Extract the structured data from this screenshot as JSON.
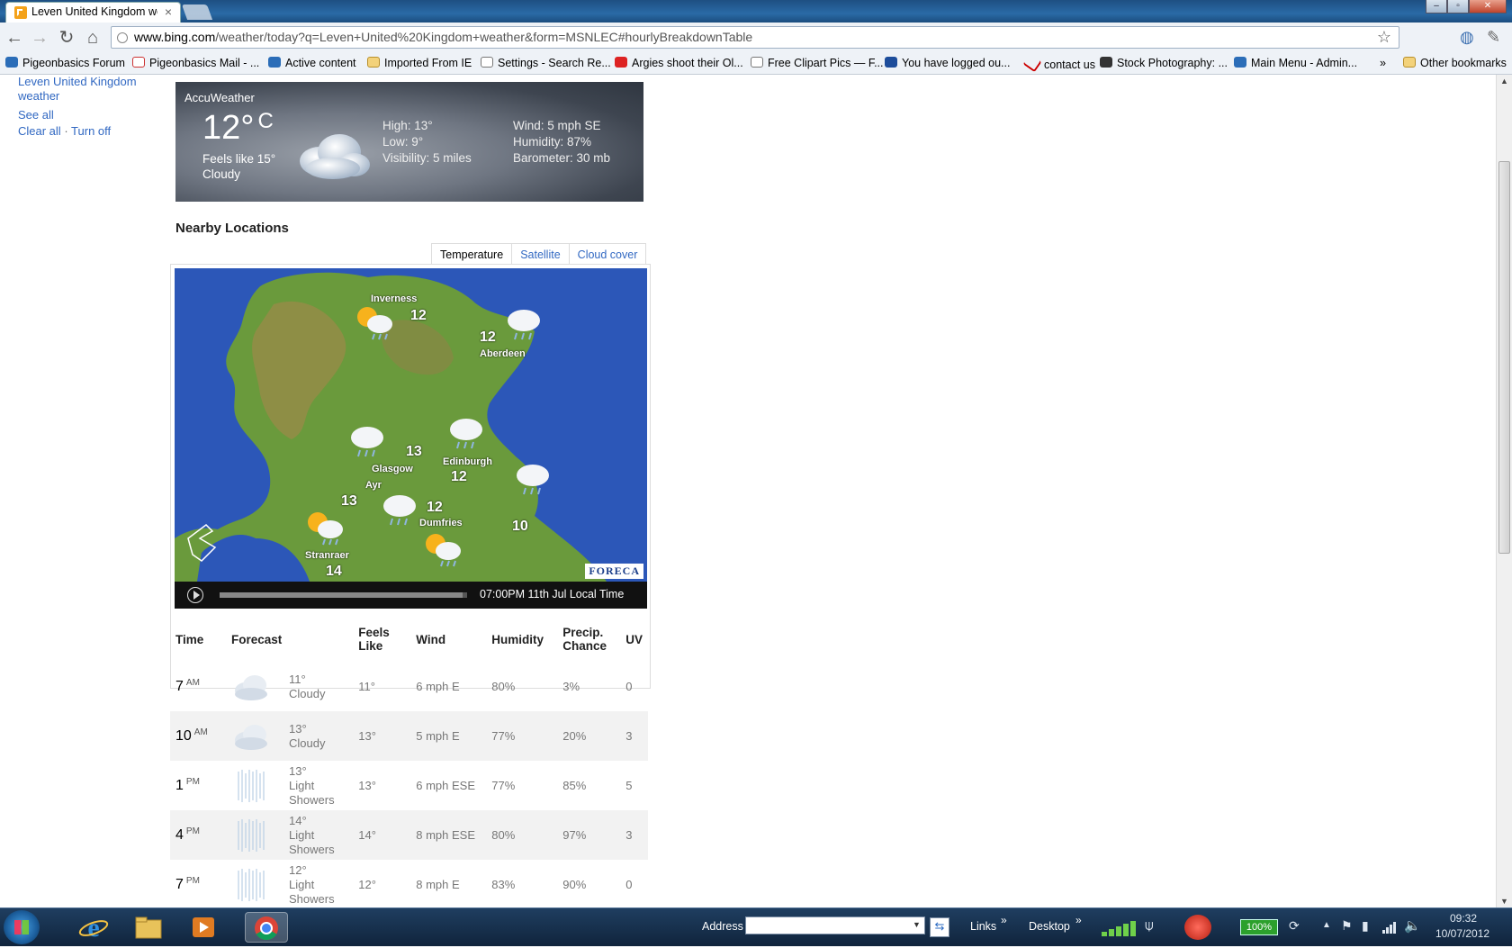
{
  "browser": {
    "tab_title": "Leven United Kingdom we",
    "tab_close": "×",
    "url_host": "www.bing.com",
    "url_path": "/weather/today?q=Leven+United%20Kingdom+weather&form=MSNLEC#hourlyBreakdownTable",
    "bookmarks": [
      {
        "label": "Pigeonbasics Forum",
        "icon": "bird-icon"
      },
      {
        "label": "Pigeonbasics Mail - ...",
        "icon": "gmail-icon"
      },
      {
        "label": "Active content",
        "icon": "bird-icon"
      },
      {
        "label": "Imported From IE",
        "icon": "folder-icon"
      },
      {
        "label": "Settings - Search Re...",
        "icon": "gear-icon"
      },
      {
        "label": "Argies shoot their Ol...",
        "icon": "red-icon"
      },
      {
        "label": "Free Clipart Pics — F...",
        "icon": "gear-icon"
      },
      {
        "label": "You have logged ou...",
        "icon": "paypal-icon"
      },
      {
        "label": "contact us",
        "icon": "tick-icon"
      },
      {
        "label": "Stock Photography: ...",
        "icon": "music-icon"
      },
      {
        "label": "Main Menu - Admin...",
        "icon": "bird-icon"
      }
    ],
    "bookmarks_overflow": "»",
    "other_bookmarks": "Other bookmarks"
  },
  "sidebar": {
    "history_link": "Leven United Kingdom weather",
    "see_all": "See all",
    "clear_all": "Clear all",
    "separator": "·",
    "turn_off": "Turn off"
  },
  "current": {
    "provider": "AccuWeather",
    "temp": "12°",
    "unit": "C",
    "feels_like": "Feels like 15°",
    "condition": "Cloudy",
    "high": "High: 13°",
    "low": "Low: 9°",
    "visibility": "Visibility: 5 miles",
    "wind": "Wind: 5 mph SE",
    "humidity": "Humidity: 87%",
    "barometer": "Barometer: 30 mb"
  },
  "nearby": {
    "title": "Nearby Locations",
    "tabs": [
      "Temperature",
      "Satellite",
      "Cloud cover"
    ],
    "map_credit": "FORECA",
    "time_label": "07:00PM 11th Jul Local Time",
    "progress": 0.98,
    "places": [
      {
        "name": "Inverness",
        "temp": "12",
        "icon": "sun-rain-icon"
      },
      {
        "name": "Aberdeen",
        "temp": "12",
        "icon": "rain-cloud-icon"
      },
      {
        "name": "Glasgow",
        "temp": "13",
        "icon": "rain-cloud-icon"
      },
      {
        "name": "Edinburgh",
        "temp": "12",
        "icon": "rain-cloud-icon"
      },
      {
        "name": "Ayr",
        "temp": "13",
        "icon": "rain-cloud-icon"
      },
      {
        "name": "Dumfries",
        "temp": "12",
        "icon": "sun-rain-icon"
      },
      {
        "name": "Stranraer",
        "temp": "14",
        "icon": "sun-rain-icon"
      },
      {
        "name": "",
        "temp": "10",
        "icon": "rain-cloud-icon"
      }
    ]
  },
  "hourly": {
    "headers": {
      "time": "Time",
      "forecast": "Forecast",
      "feels_like": "Feels Like",
      "wind": "Wind",
      "humidity": "Humidity",
      "precip": "Precip. Chance",
      "uv": "UV"
    },
    "rows": [
      {
        "hour": "7",
        "ampm": "AM",
        "temp": "11°",
        "cond": "Cloudy",
        "icon": "cloud-icon",
        "feels": "11°",
        "wind": "6 mph E",
        "humidity": "80%",
        "precip": "3%",
        "uv": "0"
      },
      {
        "hour": "10",
        "ampm": "AM",
        "temp": "13°",
        "cond": "Cloudy",
        "icon": "cloud-icon",
        "feels": "13°",
        "wind": "5 mph E",
        "humidity": "77%",
        "precip": "20%",
        "uv": "3"
      },
      {
        "hour": "1",
        "ampm": "PM",
        "temp": "13°",
        "cond": "Light Showers",
        "icon": "showers-icon",
        "feels": "13°",
        "wind": "6 mph ESE",
        "humidity": "77%",
        "precip": "85%",
        "uv": "5"
      },
      {
        "hour": "4",
        "ampm": "PM",
        "temp": "14°",
        "cond": "Light Showers",
        "icon": "showers-icon",
        "feels": "14°",
        "wind": "8 mph ESE",
        "humidity": "80%",
        "precip": "97%",
        "uv": "3"
      },
      {
        "hour": "7",
        "ampm": "PM",
        "temp": "12°",
        "cond": "Light Showers",
        "icon": "showers-icon",
        "feels": "12°",
        "wind": "8 mph E",
        "humidity": "83%",
        "precip": "90%",
        "uv": "0"
      }
    ]
  },
  "taskbar": {
    "address_label": "Address",
    "links_label": "Links",
    "desktop_label": "Desktop",
    "overflow": "»",
    "battery": "100%",
    "clock_time": "09:32",
    "clock_date": "10/07/2012"
  }
}
